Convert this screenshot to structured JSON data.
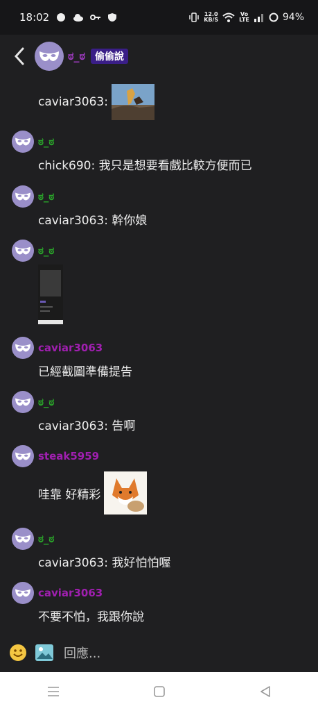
{
  "status": {
    "time": "18:02",
    "net_speed": "12.0",
    "net_unit": "KB/S",
    "vo": "Vo",
    "lte": "LTE",
    "battery": "94%"
  },
  "header": {
    "name": "ಠ_ಠ",
    "badge": "偷偷說"
  },
  "messages": [
    {
      "text": "caviar3063:"
    },
    {
      "user": "ಠ_ಠ",
      "text": "chick690: 我只是想要看戲比較方便而已"
    },
    {
      "user": "ಠ_ಠ",
      "text": "caviar3063: 幹你娘"
    },
    {
      "user": "ಠ_ಠ"
    },
    {
      "user": "caviar3063",
      "text": "已經截圖準備提告"
    },
    {
      "user": "ಠ_ಠ",
      "text": "caviar3063: 告啊"
    },
    {
      "user": "steak5959",
      "text": "哇靠 好精彩"
    },
    {
      "user": "ಠ_ಠ",
      "text": "caviar3063: 我好怕怕喔"
    },
    {
      "user": "caviar3063",
      "text": "不要不怕，我跟你說"
    }
  ],
  "composer": {
    "placeholder": "回應..."
  },
  "colors": {
    "username_green": "#2aa52a",
    "username_purple": "#a01fb0",
    "badge_bg": "#3a1e87",
    "avatar": "#9a8fc9"
  }
}
